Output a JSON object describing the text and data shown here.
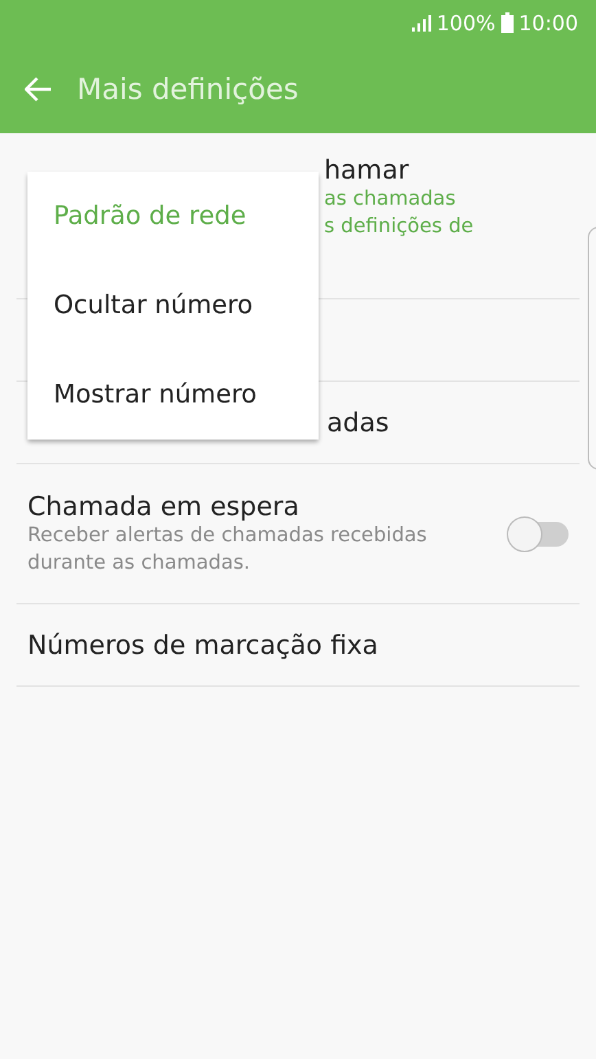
{
  "status_bar": {
    "battery": "100%",
    "time": "10:00"
  },
  "toolbar": {
    "title": "Mais definições"
  },
  "settings": [
    {
      "kind": "covered",
      "title": "hamar",
      "subtitle_lines": [
        "as chamadas",
        "s definições de"
      ]
    },
    {
      "kind": "covered"
    },
    {
      "kind": "covered",
      "title": "adas"
    },
    {
      "kind": "toggle",
      "title": "Chamada em espera",
      "subtitle": "Receber alertas de chamadas recebidas durante as chamadas.",
      "on": false
    },
    {
      "kind": "plain",
      "title": "Números de marcação fixa"
    }
  ],
  "popup_menu": [
    {
      "label": "Padrão de rede",
      "selected": true
    },
    {
      "label": "Ocultar número",
      "selected": false
    },
    {
      "label": "Mostrar número",
      "selected": false
    }
  ]
}
